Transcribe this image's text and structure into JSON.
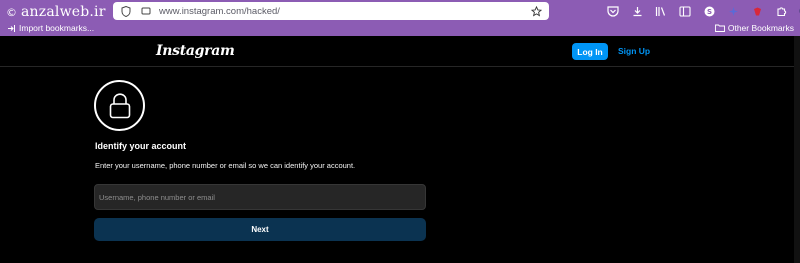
{
  "watermark": {
    "copyright": "©",
    "brand": "anzalweb.ir"
  },
  "browser": {
    "url": "www.instagram.com/hacked/",
    "bookmarks_left": "Import bookmarks...",
    "bookmarks_right": "Other Bookmarks",
    "chrome_color": "#8c5cb4"
  },
  "header": {
    "logo": "Instagram",
    "login_label": "Log In",
    "signup_label": "Sign Up"
  },
  "main": {
    "title": "Identify your account",
    "description": "Enter your username, phone number or email so we can identify your account.",
    "input_placeholder": "Username, phone number or email",
    "next_label": "Next"
  },
  "colors": {
    "accent": "#0095f6",
    "next_button": "#0b3351",
    "background": "#000000"
  }
}
